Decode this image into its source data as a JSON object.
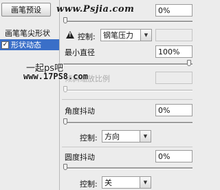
{
  "left_panel": {
    "preset_button": "画笔预设",
    "tree_tip": "画笔笔尖形状",
    "tree_shape": "形状动态"
  },
  "watermarks": {
    "site": "www.Psjia.com",
    "title": "一起ps吧",
    "url": "www.17PS8.com"
  },
  "size_jitter": {
    "value": "0%"
  },
  "control1": {
    "label": "控制:",
    "selected": "钢笔压力"
  },
  "min_diameter": {
    "label": "最小直径",
    "value": "100%"
  },
  "tilt_scale": {
    "label": "倾斜缩放比例",
    "value": ""
  },
  "angle_jitter": {
    "label": "角度抖动",
    "value": "0%"
  },
  "control2": {
    "label": "控制:",
    "selected": "方向"
  },
  "roundness_jitter": {
    "label": "圆度抖动",
    "value": "0%"
  },
  "control3": {
    "label": "控制:",
    "selected": "关"
  },
  "icons": [
    "warning-icon",
    "dropdown-arrow-icon",
    "checkbox-icon"
  ]
}
